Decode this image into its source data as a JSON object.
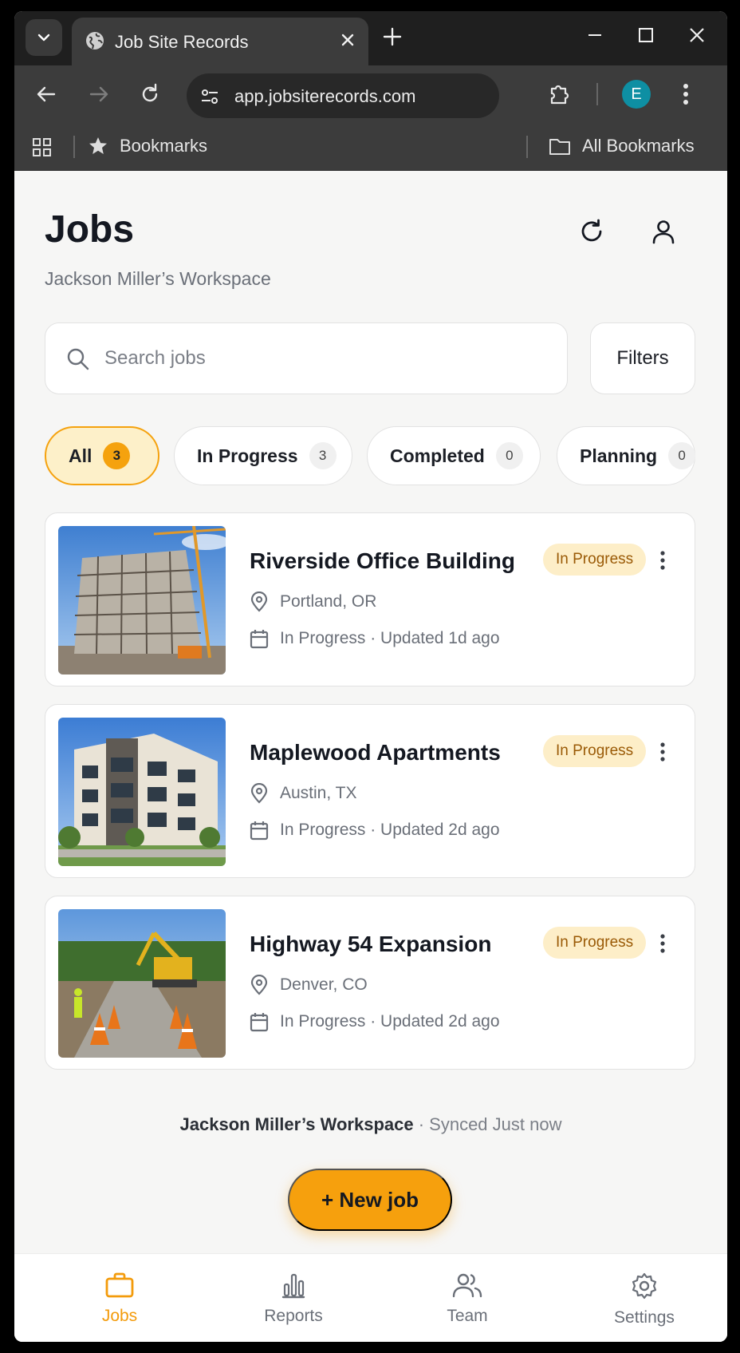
{
  "browser": {
    "tab_title": "Job Site Records",
    "url": "app.jobsiterecords.com",
    "profile_initial": "E",
    "bookmarks_label": "Bookmarks",
    "all_bookmarks_label": "All Bookmarks"
  },
  "header": {
    "title": "Jobs",
    "workspace": "Jackson Miller’s Workspace"
  },
  "search": {
    "placeholder": "Search jobs",
    "value": "",
    "filters_label": "Filters"
  },
  "chips": [
    {
      "label": "All",
      "count": "3",
      "active": true
    },
    {
      "label": "In Progress",
      "count": "3",
      "active": false
    },
    {
      "label": "Completed",
      "count": "0",
      "active": false
    },
    {
      "label": "Planning",
      "count": "0",
      "active": false
    }
  ],
  "jobs": [
    {
      "name": "Riverside Office Building",
      "status_badge": "In Progress",
      "location": "Portland, OR",
      "status_line": "In Progress · Updated 1d ago",
      "thumbnail": "construction-building-photo"
    },
    {
      "name": "Maplewood Apartments",
      "status_badge": "In Progress",
      "location": "Austin, TX",
      "status_line": "In Progress · Updated 2d ago",
      "thumbnail": "apartment-building-photo"
    },
    {
      "name": "Highway 54 Expansion",
      "status_badge": "In Progress",
      "location": "Denver, CO",
      "status_line": "In Progress · Updated 2d ago",
      "thumbnail": "road-construction-photo"
    }
  ],
  "footer": {
    "workspace": "Jackson Miller’s Workspace",
    "sync": "· Synced Just now"
  },
  "fab": {
    "label": "+ New job"
  },
  "nav": [
    {
      "label": "Jobs",
      "icon": "briefcase-icon",
      "active": true
    },
    {
      "label": "Reports",
      "icon": "bar-chart-icon",
      "active": false
    },
    {
      "label": "Team",
      "icon": "users-icon",
      "active": false
    },
    {
      "label": "Settings",
      "icon": "gear-icon",
      "active": false
    }
  ],
  "colors": {
    "accent": "#f6a00d",
    "active_chip_bg": "#fdf0c9",
    "badge_bg": "#fdeec8",
    "badge_text": "#9a5a06",
    "browser_frame": "#3c3c3c",
    "avatar": "#0e8fa3"
  }
}
